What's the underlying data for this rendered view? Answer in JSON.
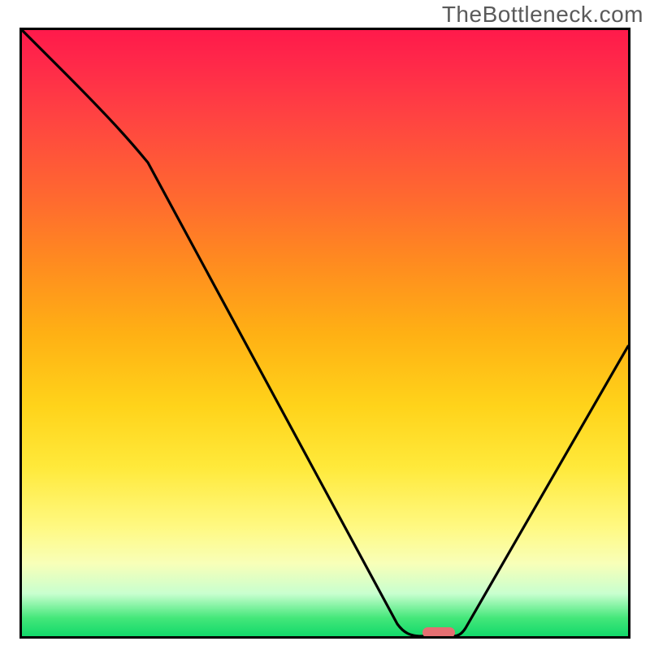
{
  "watermark": "TheBottleneck.com",
  "chart_data": {
    "type": "line",
    "title": "",
    "xlabel": "",
    "ylabel": "",
    "xlim": [
      0,
      100
    ],
    "ylim": [
      0,
      100
    ],
    "series": [
      {
        "name": "bottleneck-curve",
        "x": [
          0,
          6,
          20,
          62,
          66,
          71,
          73,
          100
        ],
        "values": [
          100,
          94,
          80,
          2,
          0,
          0,
          2,
          48
        ]
      }
    ],
    "markers": [
      {
        "name": "optimal-point",
        "x": 68.5,
        "y": 0.6,
        "color": "#e56f72"
      }
    ],
    "background": {
      "gradient_stops": [
        {
          "pos": 0,
          "color": "#ff1a4b"
        },
        {
          "pos": 14,
          "color": "#ff4242"
        },
        {
          "pos": 38,
          "color": "#ff8a20"
        },
        {
          "pos": 62,
          "color": "#ffd31a"
        },
        {
          "pos": 82,
          "color": "#fff982"
        },
        {
          "pos": 93,
          "color": "#c8ffcf"
        },
        {
          "pos": 100,
          "color": "#12d96a"
        }
      ]
    },
    "colors": {
      "line": "#000000",
      "border": "#000000",
      "marker": "#e56f72"
    }
  }
}
